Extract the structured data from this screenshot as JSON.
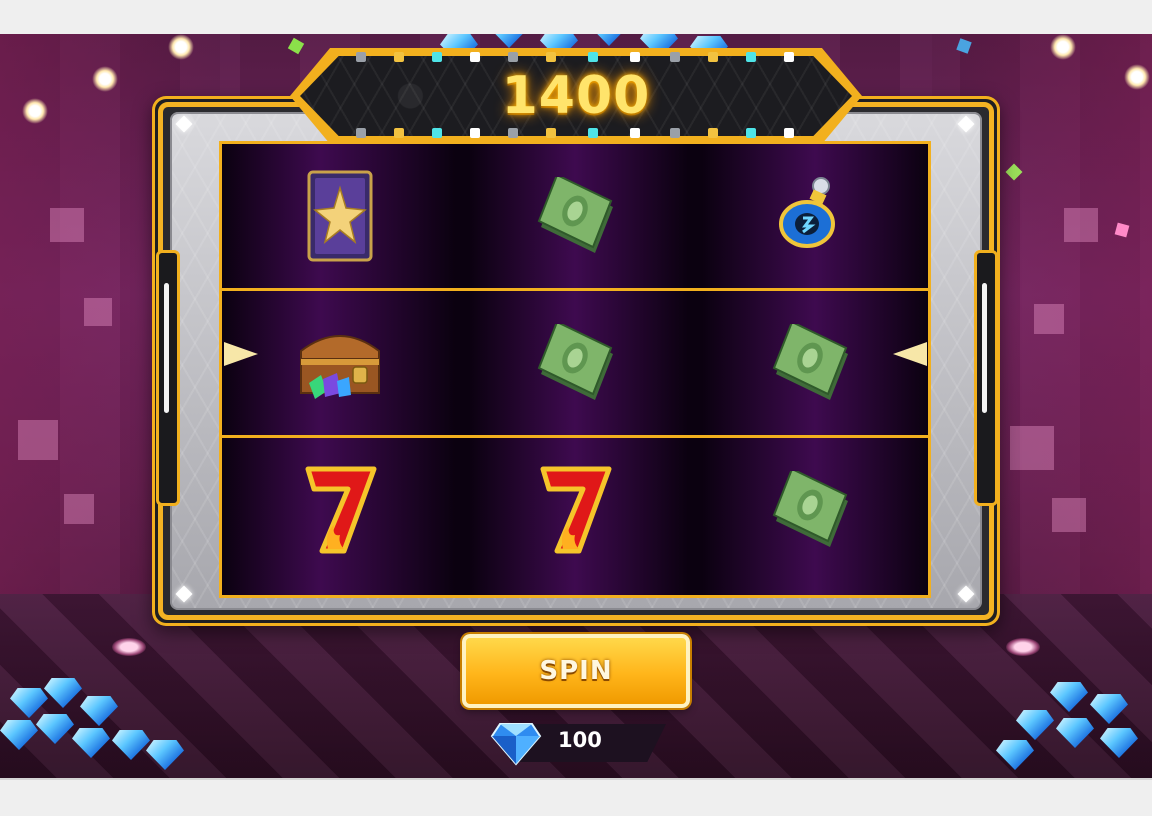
{
  "score": {
    "value": "1400"
  },
  "reels": {
    "rows": [
      {
        "cells": [
          {
            "symbol": "star-card-icon"
          },
          {
            "symbol": "cash-stack-icon"
          },
          {
            "symbol": "potion-bottle-icon"
          }
        ]
      },
      {
        "cells": [
          {
            "symbol": "treasure-chest-icon"
          },
          {
            "symbol": "cash-stack-icon"
          },
          {
            "symbol": "cash-stack-icon"
          }
        ]
      },
      {
        "cells": [
          {
            "symbol": "lucky-seven-icon"
          },
          {
            "symbol": "lucky-seven-icon"
          },
          {
            "symbol": "cash-stack-icon"
          }
        ]
      }
    ]
  },
  "spin_button": {
    "label": "SPIN"
  },
  "cost": {
    "value": "100",
    "icon": "diamond-icon"
  },
  "colors": {
    "gold": "#f2b01e",
    "score_text": "#ffe46b",
    "reel_purple": "#3e0a4f",
    "button_orange": "#ffb51a"
  }
}
